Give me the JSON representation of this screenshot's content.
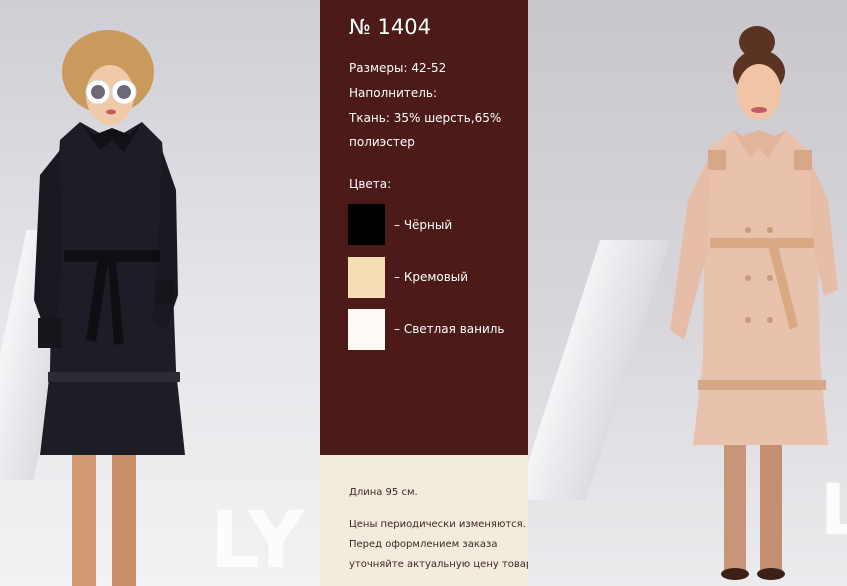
{
  "product": {
    "number": "№ 1404",
    "sizes": "Размеры: 42-52",
    "filler": "Наполнитель:",
    "fabric_line1": "Ткань: 35% шерсть,65%",
    "fabric_line2": "полиэстер",
    "colors_heading": "Цвета:",
    "colors": [
      {
        "label": "– Чёрный",
        "hex": "#000000"
      },
      {
        "label": "– Кремовый",
        "hex": "#f5deb3"
      },
      {
        "label": "– Светлая ваниль",
        "hex": "#fffaf6"
      }
    ]
  },
  "footer": {
    "length": "Длина 95 см.",
    "notice_1": "Цены периодически изменяются.",
    "notice_2": "Перед оформлением заказа",
    "notice_3": "уточняйте актуальную цену товара"
  },
  "colors": {
    "panel": "#4d1a1a",
    "bottom_panel": "#f3ebdd"
  },
  "photos": {
    "left_logo": "LY",
    "right_logo": "LY"
  }
}
